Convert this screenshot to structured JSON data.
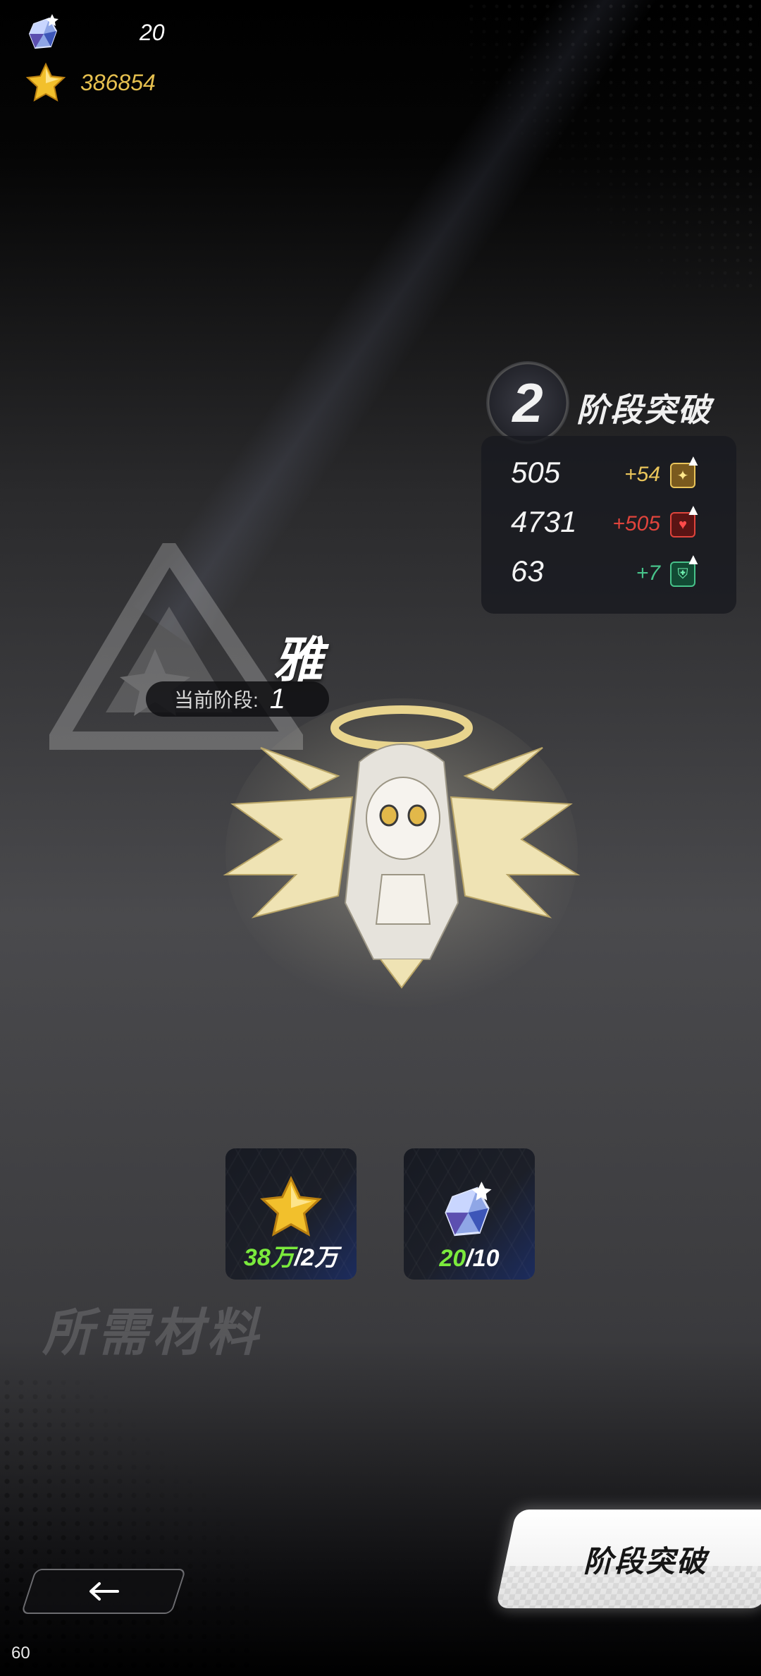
{
  "resources": {
    "gem_count": "20",
    "star_count": "386854"
  },
  "stage_break": {
    "next_stage": "2",
    "title": "阶段突破",
    "stats": [
      {
        "icon": "attack-icon",
        "base": "505",
        "increase": "+54",
        "color": "#e9c45a"
      },
      {
        "icon": "health-icon",
        "base": "4731",
        "increase": "+505",
        "color": "#e0443c"
      },
      {
        "icon": "defense-icon",
        "base": "63",
        "increase": "+7",
        "color": "#47c28a"
      }
    ]
  },
  "character": {
    "name": "雅",
    "current_stage_label": "当前阶段:",
    "current_stage_value": "1"
  },
  "materials": {
    "label": "所需材料",
    "items": [
      {
        "icon": "gold-star-icon",
        "have": "38万",
        "need": "/2万"
      },
      {
        "icon": "crystal-gem-icon",
        "have": "20",
        "need": "/10"
      }
    ]
  },
  "buttons": {
    "break_label": "阶段突破"
  },
  "fps": "60"
}
